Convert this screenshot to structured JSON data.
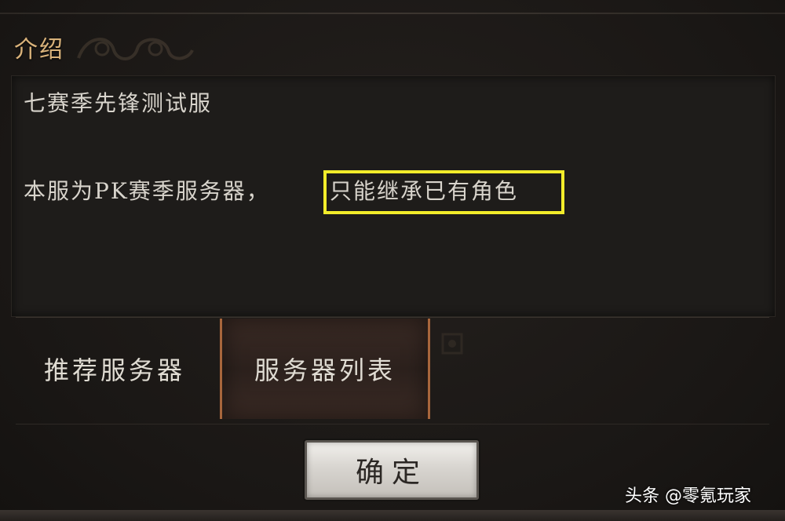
{
  "header": {
    "title": "介绍"
  },
  "intro": {
    "line1": "七赛季先锋测试服",
    "line2_prefix": "本服为PK赛季服务器，",
    "line2_highlight": "只能继承已有角色"
  },
  "tabs": [
    {
      "label": "推荐服务器",
      "active": false
    },
    {
      "label": "服务器列表",
      "active": true
    }
  ],
  "confirm": {
    "label": "确定"
  },
  "watermark": {
    "text": "头条 @零氪玩家"
  },
  "colors": {
    "highlight_border": "#f2ec2a",
    "title": "#d9b27a",
    "active_tab_border": "#a8663c"
  }
}
